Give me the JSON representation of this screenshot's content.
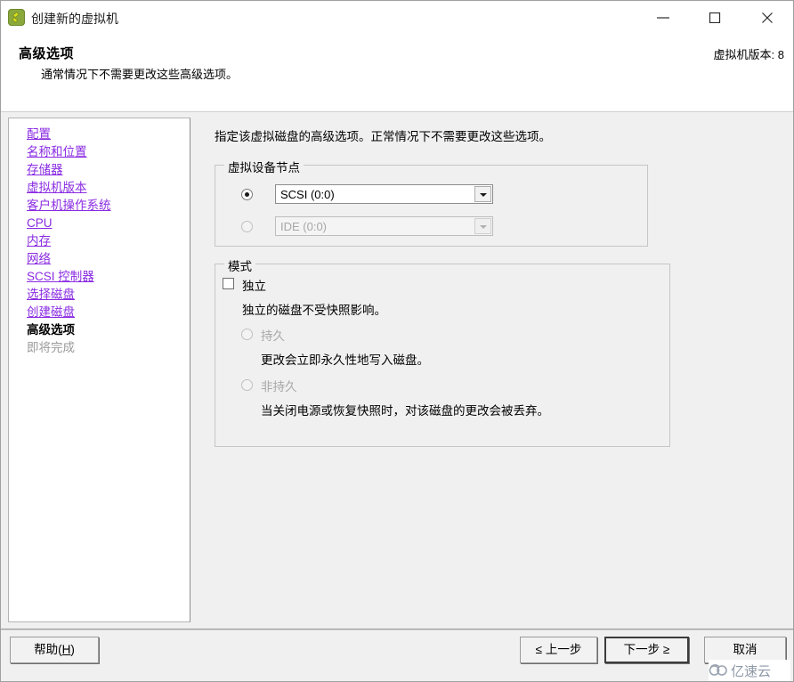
{
  "window": {
    "title": "创建新的虚拟机",
    "icon": "vm-app-icon",
    "controls": {
      "minimize": "minimize-icon",
      "maximize": "maximize-icon",
      "close": "close-icon"
    }
  },
  "header": {
    "title": "高级选项",
    "subtitle": "通常情况下不需要更改这些高级选项。",
    "version_label": "虚拟机版本: 8"
  },
  "sidebar": {
    "items": [
      {
        "label": "配置",
        "state": "link"
      },
      {
        "label": "名称和位置",
        "state": "link"
      },
      {
        "label": "存储器",
        "state": "link"
      },
      {
        "label": "虚拟机版本",
        "state": "link"
      },
      {
        "label": "客户机操作系统",
        "state": "link"
      },
      {
        "label": "CPU",
        "state": "link"
      },
      {
        "label": "内存",
        "state": "link"
      },
      {
        "label": "网络",
        "state": "link"
      },
      {
        "label": "SCSI 控制器",
        "state": "link"
      },
      {
        "label": "选择磁盘",
        "state": "link"
      },
      {
        "label": "创建磁盘",
        "state": "link"
      },
      {
        "label": "高级选项",
        "state": "current"
      },
      {
        "label": "即将完成",
        "state": "future"
      }
    ]
  },
  "main": {
    "intro": "指定该虚拟磁盘的高级选项。正常情况下不需要更改这些选项。",
    "device_node": {
      "title": "虚拟设备节点",
      "options": [
        {
          "value": "SCSI (0:0)",
          "selected": true,
          "disabled": false
        },
        {
          "value": "IDE (0:0)",
          "selected": false,
          "disabled": true
        }
      ]
    },
    "mode": {
      "title": "模式",
      "independent": {
        "label": "独立",
        "checked": false,
        "description": "独立的磁盘不受快照影响。"
      },
      "persistent": {
        "label": "持久",
        "selected": false,
        "disabled": true,
        "description": "更改会立即永久性地写入磁盘。"
      },
      "nonpersistent": {
        "label": "非持久",
        "selected": false,
        "disabled": true,
        "description": "当关闭电源或恢复快照时，对该磁盘的更改会被丢弃。"
      }
    }
  },
  "footer": {
    "help": "帮助(H)",
    "back": "≤ 上一步",
    "next": "下一步 ≥",
    "cancel": "取消"
  },
  "watermark": {
    "text": "亿速云",
    "icon": "cloud-icon"
  },
  "colors": {
    "link": "#8a2be2",
    "window_bg": "#f0f0f0",
    "panel_bg": "#ffffff",
    "disabled_text": "#a8a8a8"
  }
}
